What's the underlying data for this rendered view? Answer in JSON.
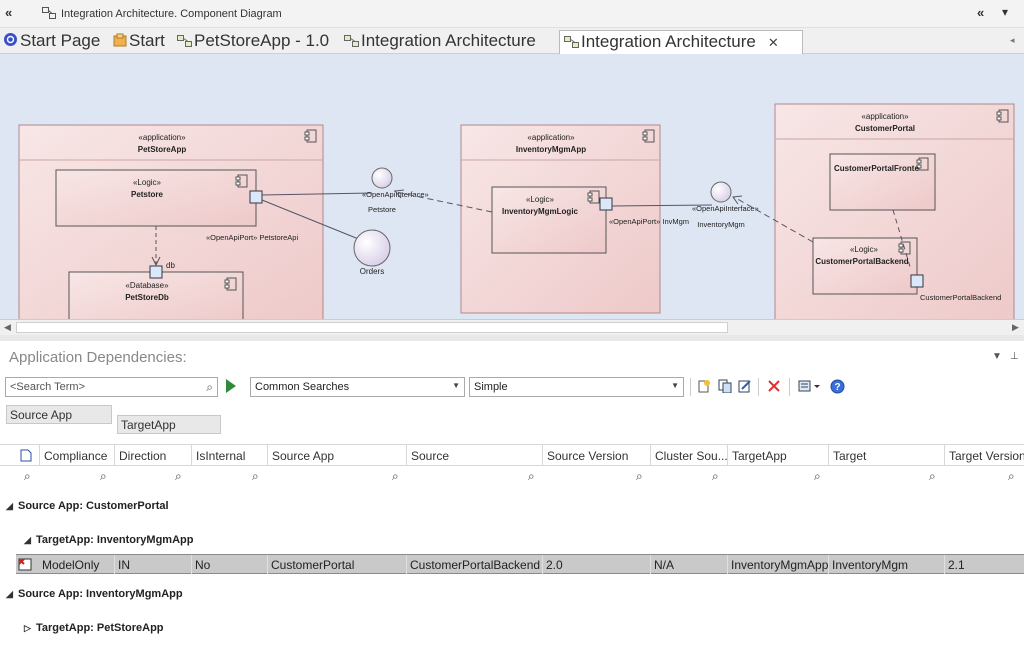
{
  "window": {
    "title": "Integration Architecture.  Component Diagram"
  },
  "tabs": [
    {
      "label": "Start Page",
      "icon": "globe-icon"
    },
    {
      "label": "Start",
      "icon": "start-icon"
    },
    {
      "label": "PetStoreApp - 1.0",
      "icon": "diagram-icon"
    },
    {
      "label": "Integration Architecture",
      "icon": "diagram-icon"
    },
    {
      "label": "Integration Architecture",
      "icon": "diagram-icon",
      "active": true
    }
  ],
  "diagram": {
    "components": [
      {
        "stereotype": "«application»",
        "name": "PetStoreApp"
      },
      {
        "stereotype": "«Logic»",
        "name": "Petstore"
      },
      {
        "stereotype": "«Database»",
        "name": "PetStoreDb"
      },
      {
        "stereotype": "«application»",
        "name": "InventoryMgmApp"
      },
      {
        "stereotype": "«Logic»",
        "name": "InventoryMgmLogic"
      },
      {
        "stereotype": "«application»",
        "name": "CustomerPortal"
      },
      {
        "stereotype": "",
        "name": "CustomerPortalFronte"
      },
      {
        "stereotype": "«Logic»",
        "name": "CustomerPortalBackend"
      }
    ],
    "labels": {
      "db": "db",
      "port_petstore": "«OpenApiPort» PetstoreApi",
      "iface_petstore_st": "«OpenApiInterface»",
      "iface_petstore": "Petstore",
      "orders": "Orders",
      "port_inv": "«OpenApiPort» InvMgm",
      "iface_inv_st": "«OpenApiInterface»",
      "iface_inv": "InventoryMgm",
      "port_cpb": "CustomerPortalBackend"
    }
  },
  "panel": {
    "title": "Application Dependencies:",
    "search_placeholder": "<Search Term>",
    "searches_value": "Common Searches",
    "view_value": "Simple",
    "group_boxes": [
      "Source App",
      "TargetApp"
    ],
    "columns": [
      "Compliance",
      "Direction",
      "IsInternal",
      "Source App",
      "Source",
      "Source Version",
      "Cluster Sou...",
      "TargetApp",
      "Target",
      "Target Version"
    ],
    "groups": [
      {
        "label": "Source App: CustomerPortal",
        "sub": [
          {
            "label": "TargetApp: InventoryMgmApp"
          }
        ]
      },
      {
        "label": "Source App: InventoryMgmApp",
        "sub": [
          {
            "label": "TargetApp: PetStoreApp"
          }
        ]
      }
    ],
    "rows": [
      [
        "ModelOnly",
        "IN",
        "No",
        "CustomerPortal",
        "CustomerPortalBackend",
        "2.0",
        "N/A",
        "InventoryMgmApp",
        "InventoryMgm",
        "2.1"
      ]
    ]
  },
  "colors": {
    "component_fill": "#f5dcdc",
    "canvas": "#dfe6f3",
    "interface_fill": "#ece6f5"
  }
}
